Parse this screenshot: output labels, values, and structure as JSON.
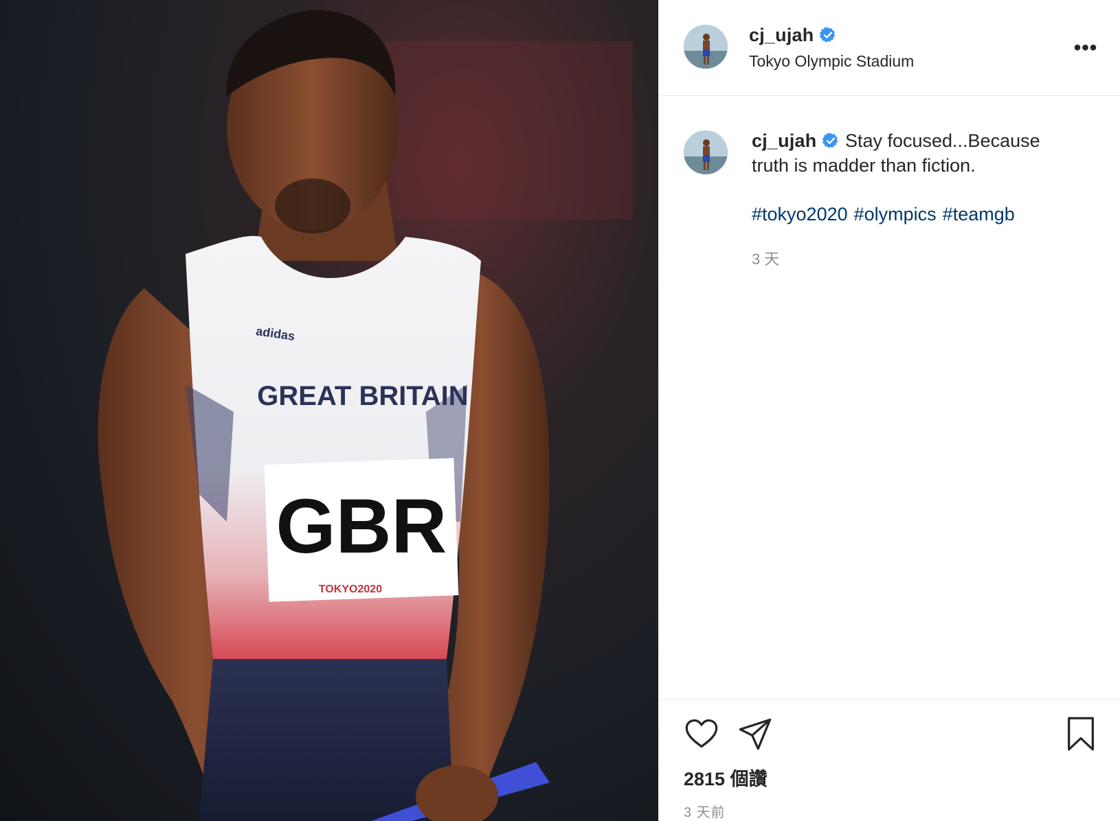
{
  "post": {
    "username": "cj_ujah",
    "verified": true,
    "location": "Tokyo Olympic Stadium",
    "more_icon": "more-horizontal-icon",
    "more_label": "•••"
  },
  "photo": {
    "jersey_text": "GREAT BRITAIN",
    "bib_text": "GBR",
    "bib_sub": "TOKYO2020",
    "brand": "adidas"
  },
  "caption": {
    "username": "cj_ujah",
    "text": "Stay focused...Because truth is madder than fiction.",
    "hashtags": [
      "#tokyo2020",
      "#olympics",
      "#teamgb"
    ],
    "relative_time": "3 天"
  },
  "actions": {
    "like_icon": "heart-icon",
    "share_icon": "paper-plane-icon",
    "save_icon": "bookmark-icon",
    "likes": "2815 個讚",
    "time": "3 天前"
  },
  "colors": {
    "verified_blue": "#3897f0",
    "hashtag_blue": "#00376b",
    "muted": "#8e8e8e"
  }
}
